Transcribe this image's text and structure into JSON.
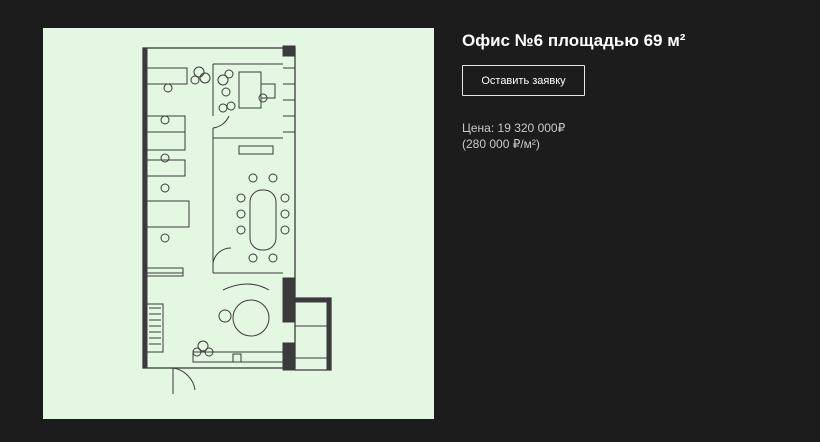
{
  "office": {
    "title": "Офис №6 площадью 69 м²",
    "cta_label": "Оставить заявку",
    "price_label": "Цена:",
    "price_value": "19 320 000₽",
    "price_per_m2": "(280 000 ₽/м²)"
  },
  "colors": {
    "background": "#1c1c1c",
    "plan_background": "#e3f7e3",
    "text": "#ffffff",
    "muted_text": "#c9c9c9"
  },
  "icons": [
    "floor-plan-drawing",
    "plant-icon",
    "door-icon",
    "desk-chair-icon",
    "meeting-table-icon"
  ]
}
